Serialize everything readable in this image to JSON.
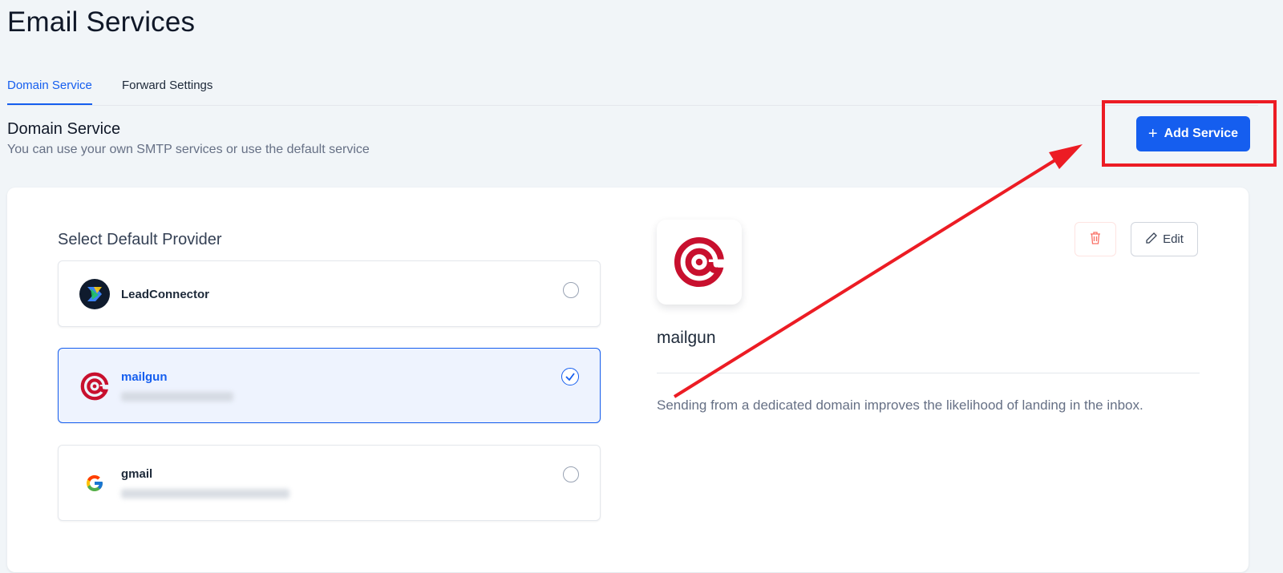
{
  "page": {
    "title": "Email Services"
  },
  "tabs": [
    {
      "label": "Domain Service",
      "active": true
    },
    {
      "label": "Forward Settings",
      "active": false
    }
  ],
  "section": {
    "title": "Domain Service",
    "subtitle": "You can use your own SMTP services or use the default service"
  },
  "actions": {
    "add_service_label": "Add Service",
    "add_service_icon": "plus-icon"
  },
  "providers": {
    "heading": "Select Default Provider",
    "items": [
      {
        "name": "LeadConnector",
        "logo": "leadconnector-logo",
        "selected": false
      },
      {
        "name": "mailgun",
        "logo": "mailgun-logo",
        "selected": true
      },
      {
        "name": "gmail",
        "logo": "google-logo",
        "selected": false
      }
    ]
  },
  "detail": {
    "name": "mailgun",
    "description": "Sending from a dedicated domain improves the likelihood of landing in the inbox.",
    "edit_label": "Edit",
    "delete_icon": "trash-icon",
    "edit_icon": "pencil-icon"
  },
  "colors": {
    "accent": "#155eef",
    "annotation": "#ec1c24",
    "mailgun_red": "#c8102e",
    "background": "#f1f5f8"
  }
}
